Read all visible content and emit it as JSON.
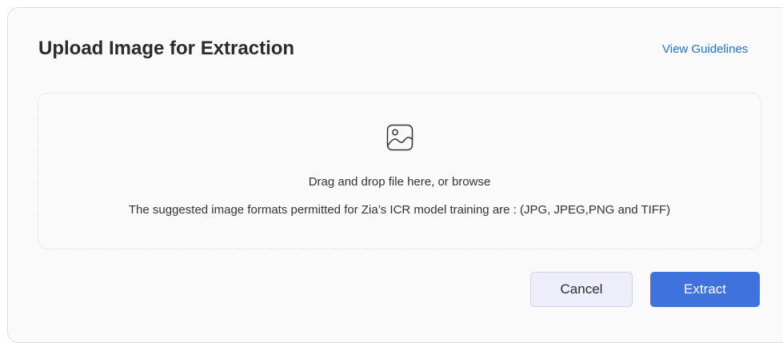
{
  "dialog": {
    "title": "Upload Image for Extraction",
    "guidelines_link": "View Guidelines"
  },
  "dropzone": {
    "icon": "image-icon",
    "drop_text": "Drag and drop file here, or browse",
    "formats_text": "The suggested image formats permitted for Zia’s ICR model training are : (JPG, JPEG,PNG and TIFF)"
  },
  "actions": {
    "cancel_label": "Cancel",
    "extract_label": "Extract"
  },
  "colors": {
    "link": "#1a73d6",
    "primary_button": "#3f72dc",
    "secondary_button": "#edeef9"
  }
}
